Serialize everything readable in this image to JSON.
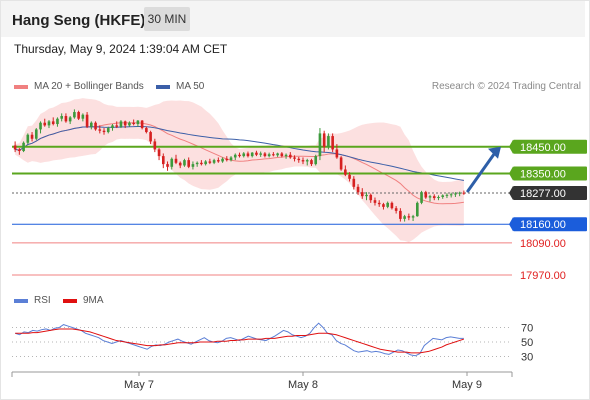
{
  "header": {
    "title": "Hang Seng (HKFE)",
    "timeframe": "30 MIN"
  },
  "datetime": "Thursday, May 9, 2024 1:39:04 AM CET",
  "legend": {
    "ma20": {
      "label": "MA 20 + Bollinger Bands",
      "color": "#f08080"
    },
    "ma50": {
      "label": "MA 50",
      "color": "#3b5fa8"
    },
    "credit": "Research © 2024 Trading Central"
  },
  "rsi_legend": {
    "rsi": {
      "label": "RSI",
      "color": "#5b7fd6"
    },
    "ma": {
      "label": "9MA",
      "color": "#e01010"
    }
  },
  "colors": {
    "up": "#3c9a3c",
    "down": "#d62020",
    "resistance": "#5aa61e",
    "support": "#1b5ddb",
    "target": "#e02020",
    "last": "#333333",
    "arrow": "#2e5fa8"
  },
  "chart_data": [
    {
      "type": "candlestick",
      "xlabels": [
        "May 7",
        "May 8",
        "May 9"
      ],
      "y_range": [
        17940,
        18640
      ],
      "levels": [
        {
          "value": 18450.0,
          "label": "18450.00",
          "kind": "resistance"
        },
        {
          "value": 18350.0,
          "label": "18350.00",
          "kind": "resistance"
        },
        {
          "value": 18277.0,
          "label": "18277.00",
          "kind": "last"
        },
        {
          "value": 18160.0,
          "label": "18160.00",
          "kind": "support"
        },
        {
          "value": 18090.0,
          "label": "18090.00",
          "kind": "target"
        },
        {
          "value": 17970.0,
          "label": "17970.00",
          "kind": "target"
        }
      ],
      "candles": [
        [
          18455,
          18470,
          18430,
          18440
        ],
        [
          18440,
          18445,
          18420,
          18434
        ],
        [
          18434,
          18470,
          18430,
          18465
        ],
        [
          18465,
          18500,
          18460,
          18495
        ],
        [
          18495,
          18505,
          18470,
          18480
        ],
        [
          18480,
          18520,
          18475,
          18515
        ],
        [
          18515,
          18545,
          18500,
          18540
        ],
        [
          18540,
          18555,
          18525,
          18530
        ],
        [
          18530,
          18550,
          18520,
          18545
        ],
        [
          18545,
          18560,
          18530,
          18535
        ],
        [
          18535,
          18560,
          18525,
          18555
        ],
        [
          18555,
          18575,
          18545,
          18565
        ],
        [
          18565,
          18575,
          18540,
          18545
        ],
        [
          18545,
          18565,
          18535,
          18560
        ],
        [
          18560,
          18590,
          18555,
          18580
        ],
        [
          18580,
          18585,
          18550,
          18555
        ],
        [
          18555,
          18575,
          18545,
          18570
        ],
        [
          18570,
          18580,
          18520,
          18525
        ],
        [
          18525,
          18545,
          18515,
          18540
        ],
        [
          18540,
          18545,
          18510,
          18515
        ],
        [
          18515,
          18530,
          18500,
          18510
        ],
        [
          18510,
          18520,
          18495,
          18505
        ],
        [
          18505,
          18525,
          18500,
          18520
        ],
        [
          18520,
          18535,
          18510,
          18530
        ],
        [
          18530,
          18545,
          18520,
          18525
        ],
        [
          18525,
          18550,
          18520,
          18545
        ],
        [
          18545,
          18548,
          18520,
          18530
        ],
        [
          18530,
          18545,
          18525,
          18540
        ],
        [
          18540,
          18552,
          18530,
          18535
        ],
        [
          18535,
          18550,
          18525,
          18548
        ],
        [
          18548,
          18550,
          18515,
          18520
        ],
        [
          18520,
          18525,
          18500,
          18505
        ],
        [
          18505,
          18510,
          18460,
          18470
        ],
        [
          18470,
          18480,
          18430,
          18440
        ],
        [
          18440,
          18445,
          18400,
          18415
        ],
        [
          18415,
          18425,
          18370,
          18385
        ],
        [
          18385,
          18395,
          18360,
          18375
        ],
        [
          18375,
          18410,
          18365,
          18405
        ],
        [
          18405,
          18420,
          18385,
          18390
        ],
        [
          18390,
          18395,
          18370,
          18380
        ],
        [
          18380,
          18405,
          18375,
          18400
        ],
        [
          18400,
          18410,
          18370,
          18375
        ],
        [
          18375,
          18395,
          18365,
          18385
        ],
        [
          18385,
          18395,
          18375,
          18390
        ],
        [
          18390,
          18400,
          18380,
          18385
        ],
        [
          18385,
          18400,
          18380,
          18395
        ],
        [
          18395,
          18405,
          18385,
          18390
        ],
        [
          18390,
          18405,
          18385,
          18400
        ],
        [
          18400,
          18410,
          18390,
          18395
        ],
        [
          18395,
          18410,
          18390,
          18405
        ],
        [
          18405,
          18415,
          18395,
          18400
        ],
        [
          18400,
          18415,
          18395,
          18410
        ],
        [
          18410,
          18425,
          18400,
          18420
        ],
        [
          18420,
          18428,
          18410,
          18415
        ],
        [
          18415,
          18430,
          18410,
          18425
        ],
        [
          18425,
          18432,
          18410,
          18415
        ],
        [
          18415,
          18430,
          18410,
          18428
        ],
        [
          18428,
          18435,
          18415,
          18420
        ],
        [
          18420,
          18432,
          18412,
          18425
        ],
        [
          18425,
          18430,
          18410,
          18415
        ],
        [
          18415,
          18428,
          18410,
          18422
        ],
        [
          18422,
          18430,
          18414,
          18418
        ],
        [
          18418,
          18428,
          18412,
          18425
        ],
        [
          18425,
          18430,
          18410,
          18415
        ],
        [
          18415,
          18425,
          18405,
          18420
        ],
        [
          18420,
          18430,
          18405,
          18410
        ],
        [
          18410,
          18418,
          18395,
          18405
        ],
        [
          18405,
          18412,
          18390,
          18400
        ],
        [
          18400,
          18410,
          18385,
          18395
        ],
        [
          18395,
          18405,
          18380,
          18400
        ],
        [
          18400,
          18405,
          18378,
          18385
        ],
        [
          18385,
          18420,
          18380,
          18415
        ],
        [
          18415,
          18520,
          18400,
          18500
        ],
        [
          18500,
          18510,
          18430,
          18450
        ],
        [
          18450,
          18500,
          18440,
          18490
        ],
        [
          18490,
          18500,
          18430,
          18440
        ],
        [
          18440,
          18460,
          18405,
          18410
        ],
        [
          18410,
          18415,
          18360,
          18365
        ],
        [
          18365,
          18380,
          18340,
          18345
        ],
        [
          18345,
          18355,
          18320,
          18330
        ],
        [
          18330,
          18340,
          18290,
          18300
        ],
        [
          18300,
          18310,
          18270,
          18280
        ],
        [
          18280,
          18295,
          18255,
          18265
        ],
        [
          18265,
          18280,
          18250,
          18270
        ],
        [
          18270,
          18275,
          18240,
          18250
        ],
        [
          18250,
          18260,
          18230,
          18240
        ],
        [
          18240,
          18250,
          18225,
          18235
        ],
        [
          18235,
          18240,
          18215,
          18225
        ],
        [
          18225,
          18245,
          18220,
          18240
        ],
        [
          18240,
          18245,
          18215,
          18220
        ],
        [
          18220,
          18228,
          18200,
          18210
        ],
        [
          18210,
          18220,
          18170,
          18180
        ],
        [
          18180,
          18195,
          18170,
          18190
        ],
        [
          18190,
          18200,
          18175,
          18185
        ],
        [
          18185,
          18195,
          18172,
          18190
        ],
        [
          18190,
          18245,
          18188,
          18240
        ],
        [
          18240,
          18285,
          18235,
          18280
        ],
        [
          18280,
          18285,
          18255,
          18260
        ],
        [
          18260,
          18270,
          18245,
          18265
        ],
        [
          18265,
          18272,
          18250,
          18258
        ],
        [
          18258,
          18268,
          18250,
          18262
        ],
        [
          18262,
          18272,
          18255,
          18268
        ],
        [
          18268,
          18276,
          18258,
          18270
        ],
        [
          18270,
          18278,
          18260,
          18272
        ],
        [
          18272,
          18280,
          18262,
          18275
        ],
        [
          18275,
          18282,
          18265,
          18278
        ],
        [
          18278,
          18286,
          18270,
          18277
        ]
      ],
      "rsi": {
        "levels": [
          70,
          50,
          30
        ],
        "range": [
          10,
          90
        ],
        "rsi_values": [
          62,
          60,
          64,
          63,
          66,
          65,
          67,
          68,
          66,
          69,
          70,
          74,
          72,
          70,
          68,
          66,
          62,
          60,
          58,
          56,
          52,
          50,
          48,
          50,
          52,
          50,
          48,
          46,
          44,
          42,
          40,
          44,
          46,
          45,
          47,
          50,
          52,
          54,
          51,
          49,
          47,
          50,
          53,
          56,
          52,
          50,
          49,
          51,
          55,
          56,
          54,
          52,
          55,
          58,
          56,
          54,
          53,
          52,
          55,
          58,
          62,
          66,
          64,
          60,
          58,
          56,
          58,
          62,
          70,
          76,
          70,
          62,
          60,
          52,
          48,
          46,
          42,
          38,
          36,
          37,
          38,
          36,
          37,
          36,
          34,
          33,
          36,
          39,
          38,
          35,
          32,
          31,
          34,
          45,
          50,
          55,
          54,
          53,
          56,
          57,
          56,
          55,
          55
        ],
        "ma_values": [
          62,
          62,
          62,
          62,
          63,
          63,
          64,
          65,
          66,
          67,
          68,
          68,
          68,
          68,
          67,
          66,
          65,
          64,
          62,
          60,
          58,
          56,
          54,
          52,
          51,
          50,
          49,
          48,
          47,
          46,
          45,
          45,
          45,
          46,
          46,
          47,
          48,
          49,
          49,
          49,
          49,
          49,
          50,
          50,
          50,
          50,
          51,
          51,
          51,
          52,
          52,
          53,
          53,
          54,
          54,
          54,
          54,
          55,
          55,
          55,
          56,
          57,
          58,
          58,
          59,
          59,
          59,
          60,
          61,
          62,
          62,
          62,
          61,
          60,
          58,
          56,
          54,
          52,
          50,
          48,
          46,
          44,
          42,
          40,
          39,
          38,
          37,
          36,
          36,
          36,
          35,
          35,
          35,
          36,
          37,
          39,
          41,
          43,
          46,
          48,
          50,
          52,
          54
        ]
      }
    }
  ]
}
